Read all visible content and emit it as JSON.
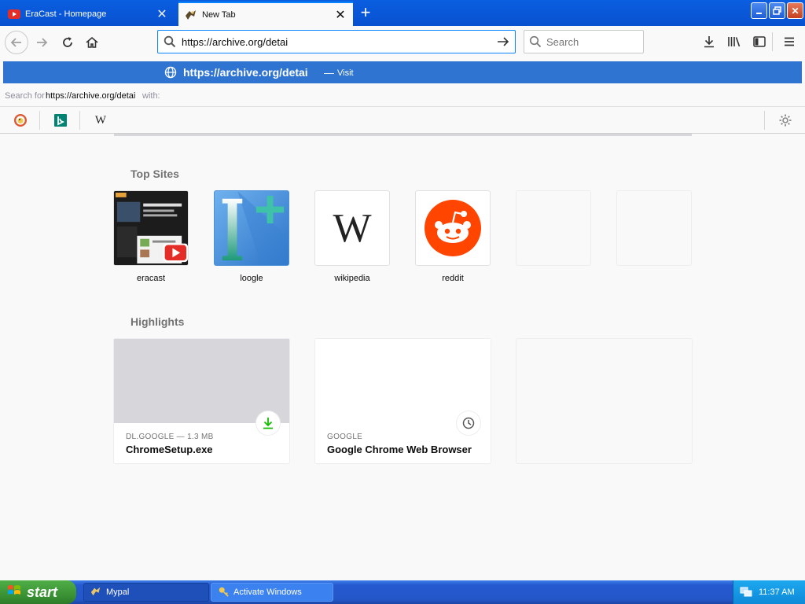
{
  "tabs": [
    {
      "title": "EraCast - Homepage",
      "active": false,
      "icon": "youtube-like-icon"
    },
    {
      "title": "New Tab",
      "active": true,
      "icon": "eracast-favicon-icon"
    }
  ],
  "navbar": {
    "url_value": "https://archive.org/detai",
    "search_placeholder": "Search"
  },
  "dropdown": {
    "suggestion_url": "https://archive.org/detai",
    "suggestion_dash": "—",
    "suggestion_action": "Visit",
    "search_for_prefix": "Search for",
    "search_for_query": "https://archive.org/detai",
    "search_for_suffix": "with:",
    "engines": [
      "duckduckgo-icon",
      "bing-icon",
      "wikipedia-icon"
    ],
    "accent_color": "#2f74d1"
  },
  "top_sites": {
    "title": "Top Sites",
    "sites": [
      {
        "label": "eracast"
      },
      {
        "label": "loogle"
      },
      {
        "label": "wikipedia"
      },
      {
        "label": "reddit"
      },
      {
        "label": ""
      },
      {
        "label": ""
      }
    ]
  },
  "highlights": {
    "title": "Highlights",
    "cards": [
      {
        "source": "DL.GOOGLE — 1.3 MB",
        "title": "ChromeSetup.exe",
        "badge": "download-icon"
      },
      {
        "source": "GOOGLE",
        "title": "Google Chrome Web Browser",
        "badge": "clock-icon"
      },
      {
        "source": "",
        "title": "",
        "badge": ""
      }
    ]
  },
  "taskbar": {
    "start_label": "start",
    "tasks": [
      {
        "label": "Mypal"
      },
      {
        "label": "Activate Windows"
      }
    ],
    "clock": "11:37 AM"
  }
}
